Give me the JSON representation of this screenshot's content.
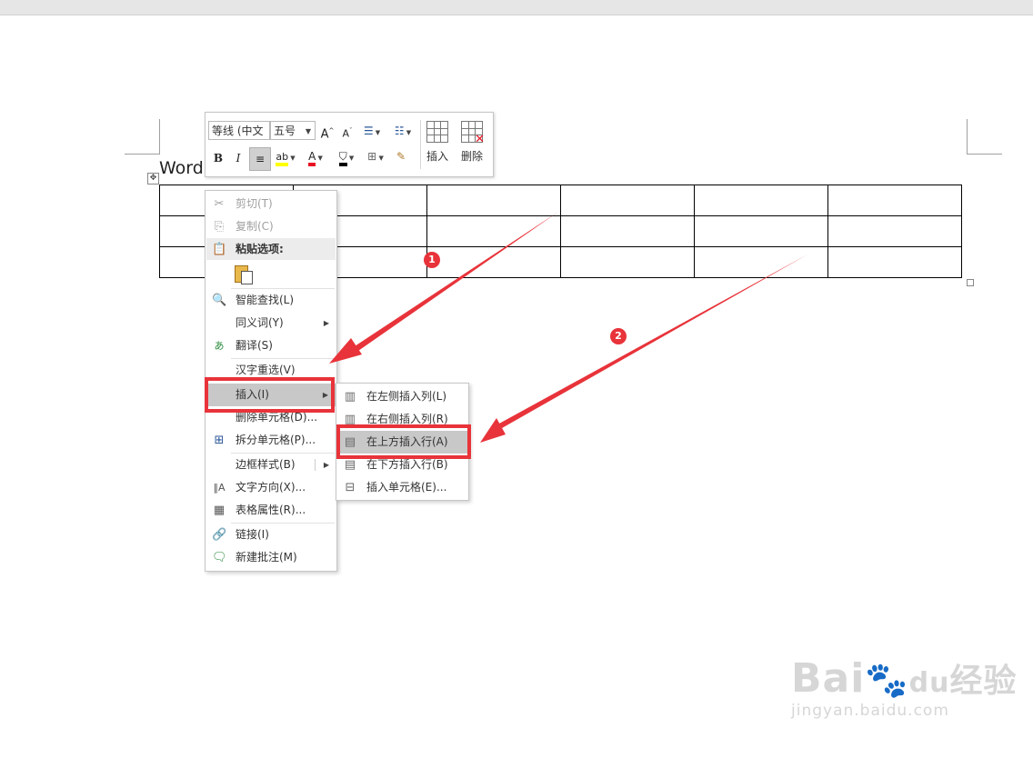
{
  "document": {
    "title_fragment": "Word",
    "move_handle_glyph": "✥",
    "table_rows": 3,
    "table_cols": 6
  },
  "mini_toolbar": {
    "font_name": "等线 (中文",
    "font_size": "五号",
    "grow_font": "A",
    "shrink_font": "A",
    "bold": "B",
    "italic": "I",
    "highlight_label": "ab",
    "font_color_label": "A",
    "insert_label": "插入",
    "delete_label": "删除"
  },
  "context_menu": {
    "items": [
      {
        "label": "剪切(T)",
        "icon": "scissors-icon",
        "disabled": true
      },
      {
        "label": "复制(C)",
        "icon": "copy-icon",
        "disabled": true
      },
      {
        "label": "粘贴选项:",
        "icon": "paste-icon",
        "disabled": false
      },
      {
        "label": "智能查找(L)",
        "icon": "smart-lookup-icon",
        "disabled": false
      },
      {
        "label": "同义词(Y)",
        "icon": "",
        "disabled": false,
        "submenu": true
      },
      {
        "label": "翻译(S)",
        "icon": "translate-icon",
        "disabled": false
      },
      {
        "label": "汉字重选(V)",
        "icon": "",
        "disabled": false
      },
      {
        "label": "插入(I)",
        "icon": "",
        "disabled": false,
        "submenu": true,
        "highlighted": true
      },
      {
        "label": "删除单元格(D)...",
        "icon": "",
        "disabled": false
      },
      {
        "label": "拆分单元格(P)...",
        "icon": "split-cells-icon",
        "disabled": false
      },
      {
        "label": "边框样式(B)",
        "icon": "",
        "disabled": false,
        "submenu": true
      },
      {
        "label": "文字方向(X)...",
        "icon": "text-direction-icon",
        "disabled": false
      },
      {
        "label": "表格属性(R)...",
        "icon": "table-properties-icon",
        "disabled": false
      },
      {
        "label": "链接(I)",
        "icon": "link-icon",
        "disabled": false
      },
      {
        "label": "新建批注(M)",
        "icon": "new-comment-icon",
        "disabled": false
      }
    ]
  },
  "insert_submenu": {
    "items": [
      {
        "label": "在左侧插入列(L)",
        "icon": "insert-left-icon"
      },
      {
        "label": "在右侧插入列(R)",
        "icon": "insert-right-icon"
      },
      {
        "label": "在上方插入行(A)",
        "icon": "insert-above-icon",
        "highlighted": true
      },
      {
        "label": "在下方插入行(B)",
        "icon": "insert-below-icon"
      },
      {
        "label": "插入单元格(E)...",
        "icon": "insert-cells-icon"
      }
    ]
  },
  "annotations": {
    "step1": "1",
    "step2": "2",
    "accent_color": "#e8333a"
  },
  "watermark": {
    "main": "Bai",
    "paw": "du",
    "cn": "经验",
    "sub": "jingyan.baidu.com"
  }
}
